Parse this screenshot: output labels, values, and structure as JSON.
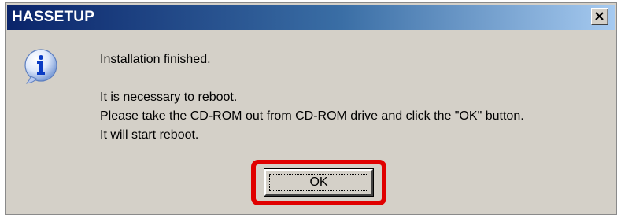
{
  "window": {
    "title": "HASSETUP",
    "close_symbol": "X"
  },
  "icon": {
    "name": "info-icon",
    "glyph": "i"
  },
  "message": {
    "line1": "Installation finished.",
    "line2": "It is necessary to reboot.",
    "line3": "Please take the CD-ROM out from CD-ROM drive and click the \"OK\" button.",
    "line4": "It will start reboot."
  },
  "buttons": {
    "ok_label": "OK"
  },
  "colors": {
    "highlight": "#e00000",
    "titlebar_start": "#0a246a",
    "titlebar_end": "#a6caf0",
    "dialog_bg": "#d4d0c8"
  }
}
